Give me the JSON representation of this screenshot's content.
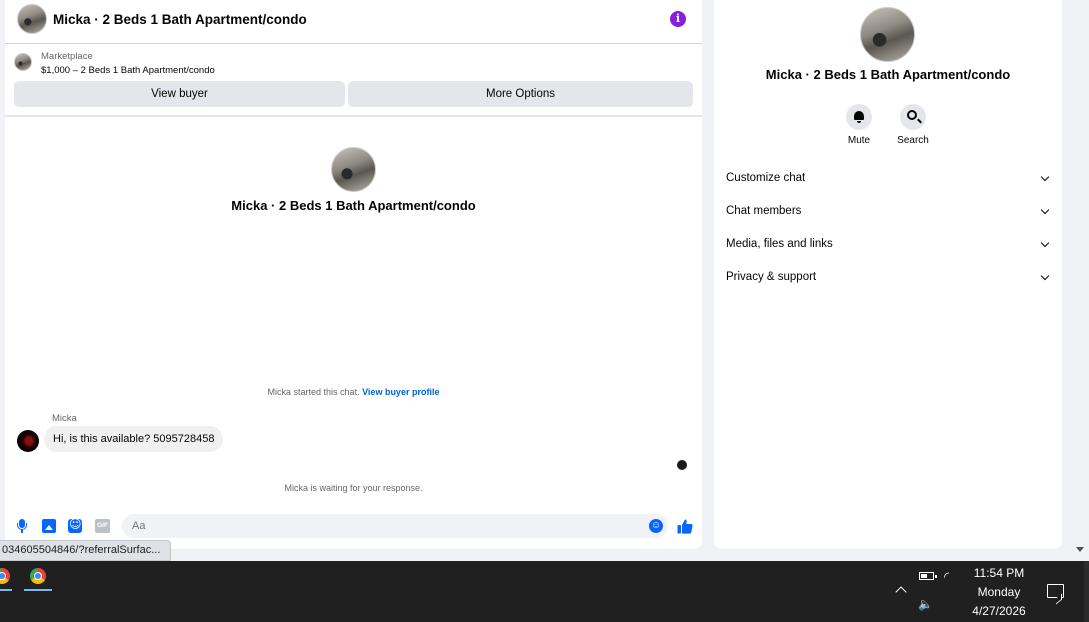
{
  "chat": {
    "header_title": "Micka · 2 Beds 1 Bath Apartment/condo",
    "marketplace_label": "Marketplace",
    "listing_line": "$1,000 – 2 Beds 1 Bath Apartment/condo",
    "view_buyer_label": "View buyer",
    "more_options_label": "More Options",
    "intro_title": "Micka · 2 Beds 1 Bath Apartment/condo",
    "started_text": "Micka started this chat.",
    "view_profile_link": "View buyer profile",
    "sender_name": "Micka",
    "message_text": "Hi, is this available? 5095728458",
    "waiting_text": "Micka is waiting for your response.",
    "input_placeholder": "Aa",
    "gif_label": "GIF",
    "accent_color": "#0866ff",
    "info_color": "#8a1ee0",
    "icons": [
      "info-icon",
      "microphone-icon",
      "photo-icon",
      "sticker-icon",
      "gif-icon",
      "emoji-icon",
      "like-icon"
    ]
  },
  "info_panel": {
    "title": "Micka · 2 Beds 1 Bath Apartment/condo",
    "actions": [
      {
        "label": "Mute",
        "icon": "bell-icon"
      },
      {
        "label": "Search",
        "icon": "search-icon"
      }
    ],
    "sections": [
      {
        "label": "Customize chat"
      },
      {
        "label": "Chat members"
      },
      {
        "label": "Media, files and links"
      },
      {
        "label": "Privacy & support"
      }
    ]
  },
  "status_bar": {
    "url_text": "034605504846/?referralSurfac..."
  },
  "taskbar": {
    "time": "11:54 PM",
    "day": "Monday",
    "date": "4/27/2026",
    "pinned_apps": [
      "chrome-icon",
      "chrome-icon"
    ]
  }
}
